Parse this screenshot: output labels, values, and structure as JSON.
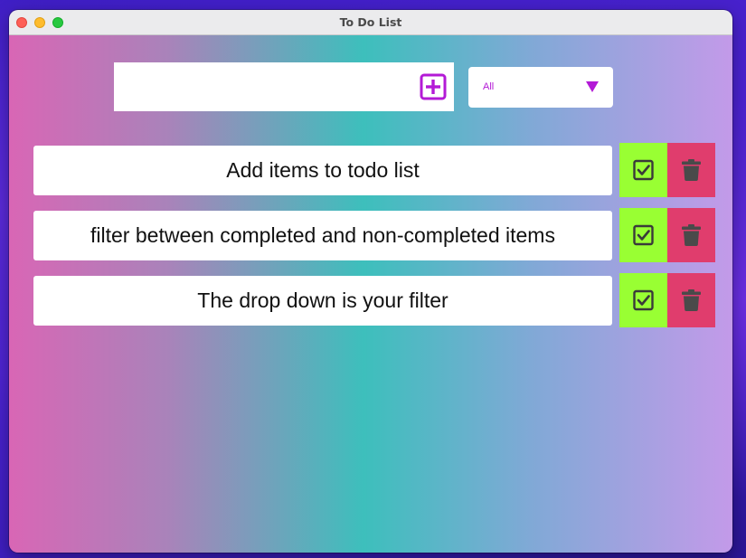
{
  "window": {
    "title": "To Do List"
  },
  "todo_input": {
    "value": "",
    "placeholder": ""
  },
  "add_button": {
    "icon": "plus-square-icon",
    "color": "#b31ad6"
  },
  "filter": {
    "selected": "All",
    "icon": "triangle-down-icon"
  },
  "todos": [
    {
      "text": "Add items to todo list"
    },
    {
      "text": "filter between completed and non-completed items"
    },
    {
      "text": "The drop down is your filter"
    }
  ],
  "actions": {
    "complete_icon": "check-square-icon",
    "delete_icon": "trash-icon",
    "complete_color": "#99ff33",
    "delete_color": "#e03d6d"
  }
}
